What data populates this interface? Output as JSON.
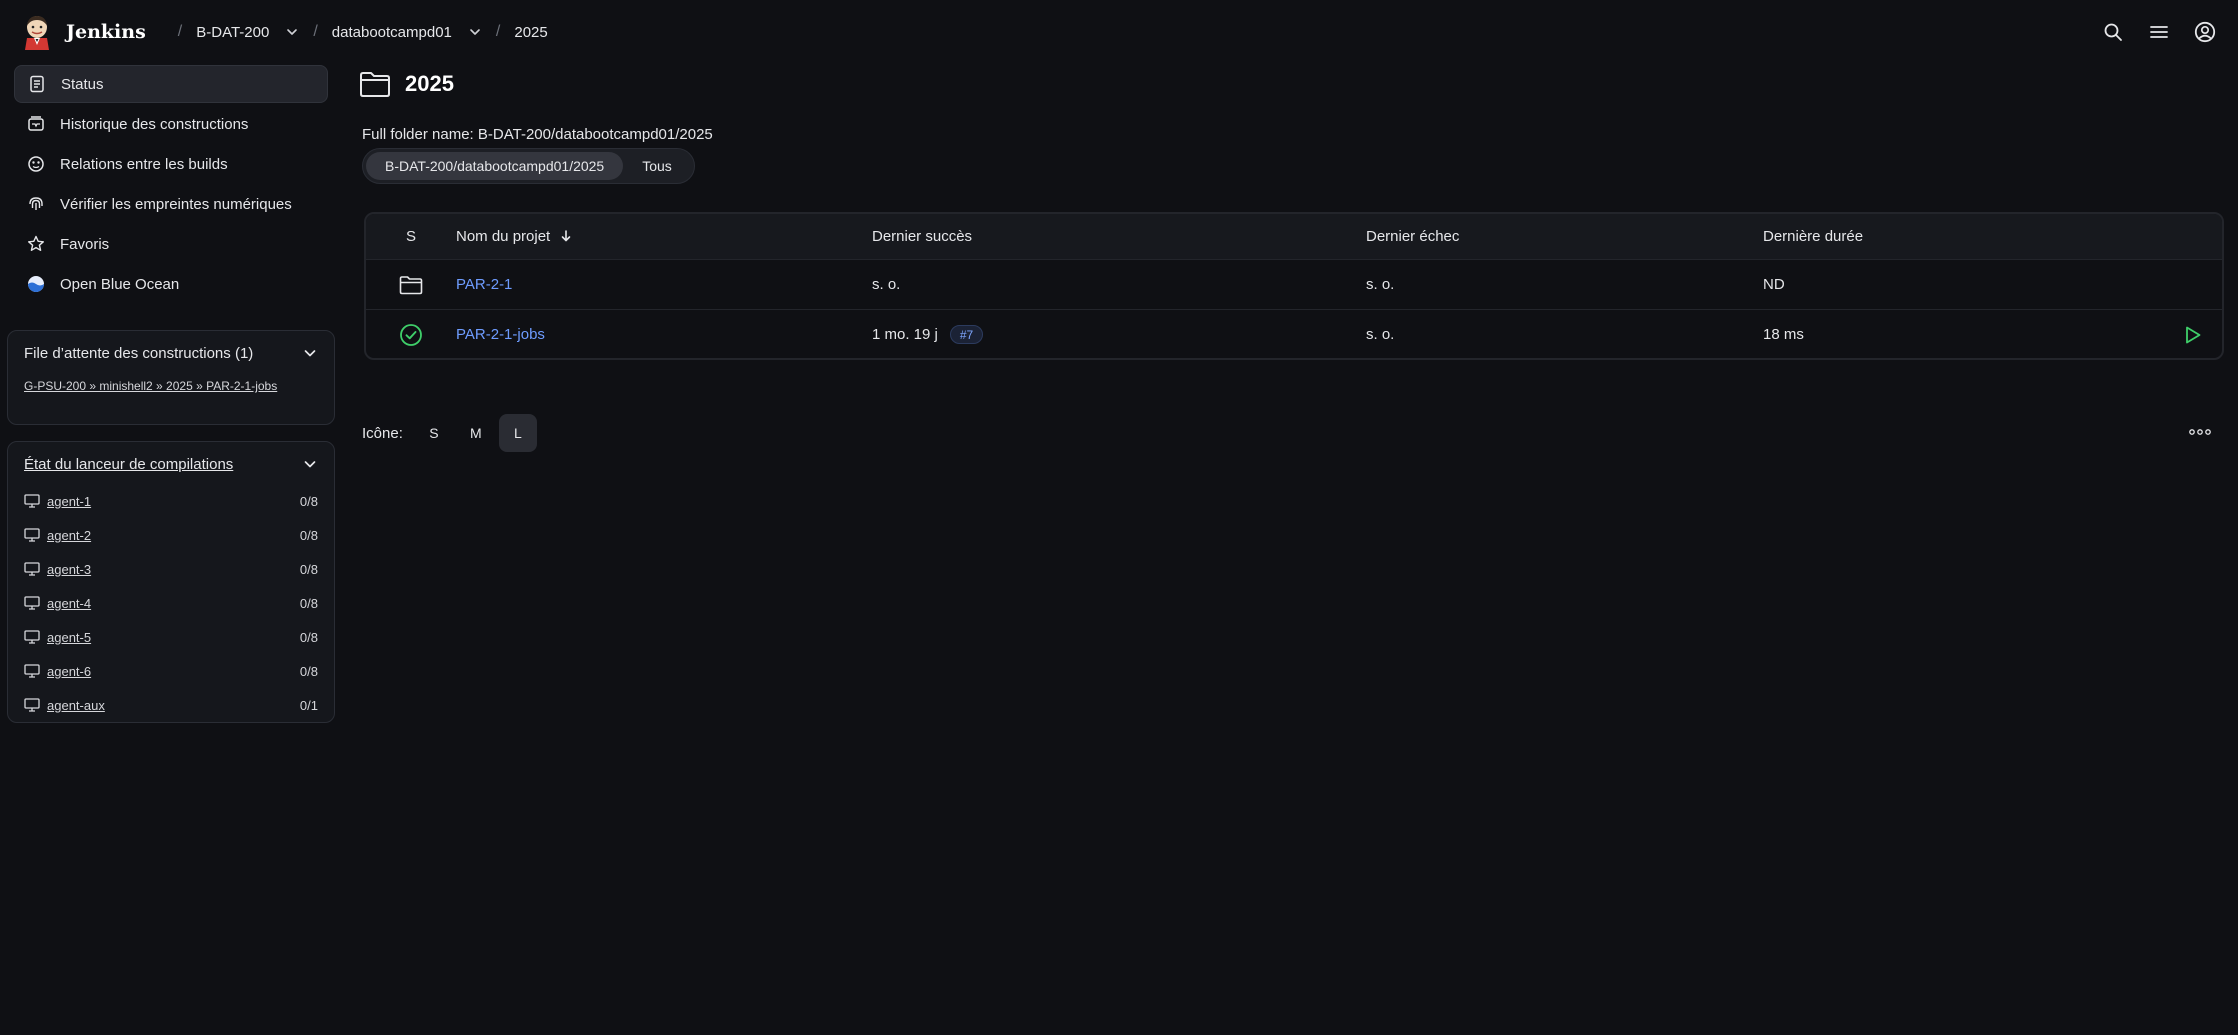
{
  "header": {
    "app_name": "Jenkins",
    "breadcrumbs": [
      {
        "label": "B-DAT-200",
        "has_menu": true
      },
      {
        "label": "databootcampd01",
        "has_menu": true
      },
      {
        "label": "2025",
        "has_menu": false
      }
    ],
    "actions": [
      "search-icon",
      "menu-icon",
      "account-icon"
    ]
  },
  "sidebar": {
    "items": [
      {
        "label": "Status",
        "icon": "status-icon",
        "active": true
      },
      {
        "label": "Historique des constructions",
        "icon": "build-history-icon"
      },
      {
        "label": "Relations entre les builds",
        "icon": "relations-icon"
      },
      {
        "label": "Vérifier les empreintes numériques",
        "icon": "fingerprint-icon"
      },
      {
        "label": "Favoris",
        "icon": "star-icon"
      },
      {
        "label": "Open Blue Ocean",
        "icon": "blue-ocean-icon"
      }
    ]
  },
  "build_queue": {
    "title": "File d’attente des constructions (1)",
    "items": [
      "G-PSU-200 » minishell2 » 2025 » PAR-2-1-jobs"
    ]
  },
  "executors": {
    "title": "État du lanceur de compilations",
    "agents": [
      {
        "name": "agent-1",
        "count": "0/8"
      },
      {
        "name": "agent-2",
        "count": "0/8"
      },
      {
        "name": "agent-3",
        "count": "0/8"
      },
      {
        "name": "agent-4",
        "count": "0/8"
      },
      {
        "name": "agent-5",
        "count": "0/8"
      },
      {
        "name": "agent-6",
        "count": "0/8"
      },
      {
        "name": "agent-aux",
        "count": "0/1"
      }
    ]
  },
  "main": {
    "title": "2025",
    "full_folder_name": "Full folder name: B-DAT-200/databootcampd01/2025",
    "tabs": [
      {
        "label": "B-DAT-200/databootcampd01/2025",
        "active": true
      },
      {
        "label": "Tous",
        "active": false
      }
    ],
    "table": {
      "headers": {
        "s": "S",
        "name": "Nom du projet",
        "last_success": "Dernier succès",
        "last_failure": "Dernier échec",
        "last_duration": "Dernière durée"
      },
      "rows": [
        {
          "status_icon": "folder-icon",
          "name": "PAR-2-1",
          "last_success": "s. o.",
          "build": "",
          "last_failure": "s. o.",
          "last_duration": "ND"
        },
        {
          "status_icon": "success-icon",
          "name": "PAR-2-1-jobs",
          "last_success": "1 mo. 19 j",
          "build": "#7",
          "last_failure": "s. o.",
          "last_duration": "18 ms"
        }
      ]
    },
    "icon_size": {
      "label": "Icône:",
      "options": [
        "S",
        "M",
        "L"
      ],
      "selected": "L"
    }
  },
  "colors": {
    "background": "#0f1014",
    "link": "#6e9cff",
    "success": "#3fcf6a",
    "badge_text": "#7ea6ff"
  }
}
